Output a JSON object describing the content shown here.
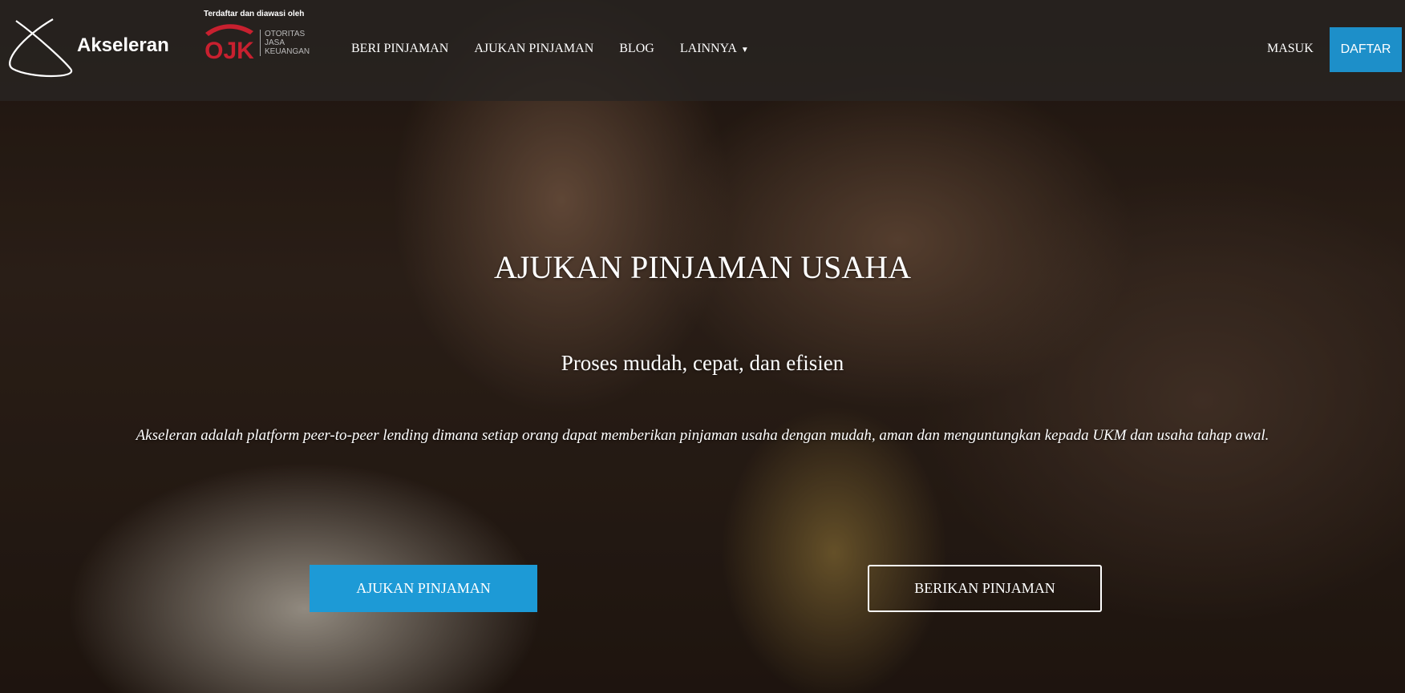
{
  "brand": {
    "name": "Akseleran"
  },
  "ojk": {
    "caption": "Terdaftar dan diawasi oleh",
    "logo_letters": "OJK",
    "name_lines": [
      "OTORITAS",
      "JASA",
      "KEUANGAN"
    ]
  },
  "nav": {
    "items": [
      "BERI PINJAMAN",
      "AJUKAN PINJAMAN",
      "BLOG",
      "LAINNYA"
    ],
    "dropdown_icon": "caret-down-icon",
    "login_label": "MASUK",
    "register_label": "DAFTAR"
  },
  "hero": {
    "headline": "AJUKAN PINJAMAN USAHA",
    "subtitle": "Proses mudah, cepat, dan efisien",
    "description": "Akseleran adalah platform peer-to-peer lending dimana setiap orang dapat memberikan pinjaman usaha dengan mudah, aman dan menguntungkan kepada UKM dan usaha tahap awal.",
    "primary_button": "AJUKAN PINJAMAN",
    "secondary_button": "BERIKAN PINJAMAN"
  },
  "colors": {
    "accent": "#1d9ad6",
    "register": "#1d8fc9",
    "ojk_red": "#c8202f"
  }
}
